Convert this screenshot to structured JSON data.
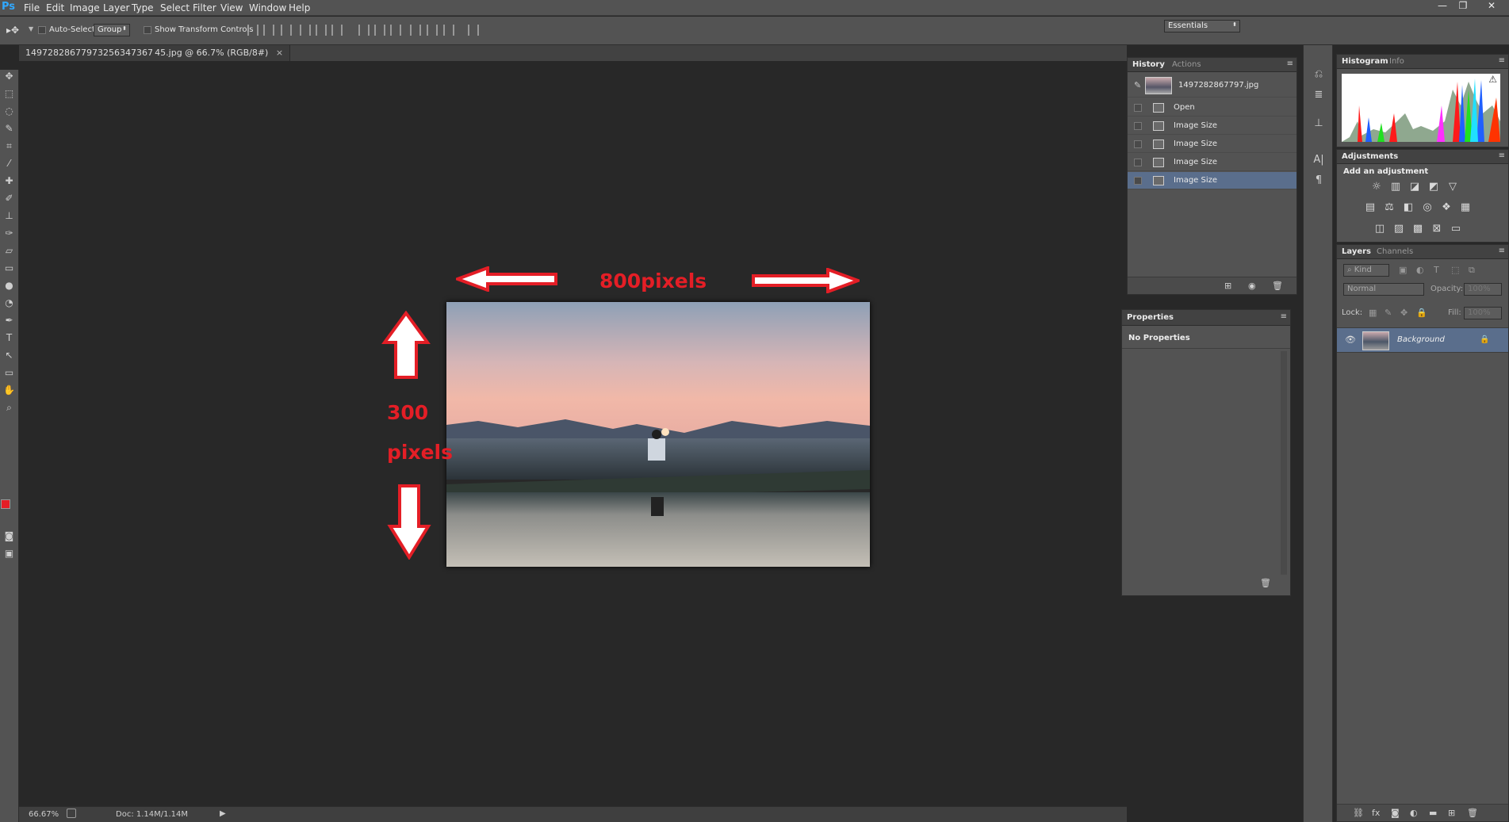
{
  "app": {
    "logo": "Ps"
  },
  "menu": [
    "File",
    "Edit",
    "Image",
    "Layer",
    "Type",
    "Select",
    "Filter",
    "View",
    "Window",
    "Help"
  ],
  "window_controls": {
    "minimize": "—",
    "restore": "❐",
    "close": "✕"
  },
  "options_bar": {
    "auto_select_label": "Auto-Select:",
    "auto_select_value": "Group",
    "show_transform_label": "Show Transform Controls",
    "workspace": "Essentials"
  },
  "document": {
    "tab_title": "14972828677973256347367 45.jpg @ 66.7% (RGB/8#)",
    "close": "×"
  },
  "annotations": {
    "width_label": "800pixels",
    "height_label_1": "300",
    "height_label_2": "pixels"
  },
  "status": {
    "zoom": "66.67%",
    "doc": "Doc: 1.14M/1.14M"
  },
  "history_panel": {
    "tabs": [
      "History",
      "Actions"
    ],
    "snapshot_name": "1497282867797.jpg",
    "steps": [
      "Open",
      "Image Size",
      "Image Size",
      "Image Size",
      "Image Size"
    ]
  },
  "properties_panel": {
    "title": "Properties",
    "content": "No Properties"
  },
  "histogram_panel": {
    "tabs": [
      "Histogram",
      "Info"
    ]
  },
  "adjustments_panel": {
    "title": "Adjustments",
    "subtitle": "Add an adjustment"
  },
  "layers_panel": {
    "tabs": [
      "Layers",
      "Channels"
    ],
    "filter": "Kind",
    "blend_mode": "Normal",
    "opacity_label": "Opacity:",
    "opacity_value": "100%",
    "lock_label": "Lock:",
    "fill_label": "Fill:",
    "fill_value": "100%",
    "layer_name": "Background"
  },
  "colors": {
    "foreground": "#e41e26",
    "background": "#ffffff",
    "annotation": "#e41e26",
    "selected_row": "#5a6e8c"
  }
}
